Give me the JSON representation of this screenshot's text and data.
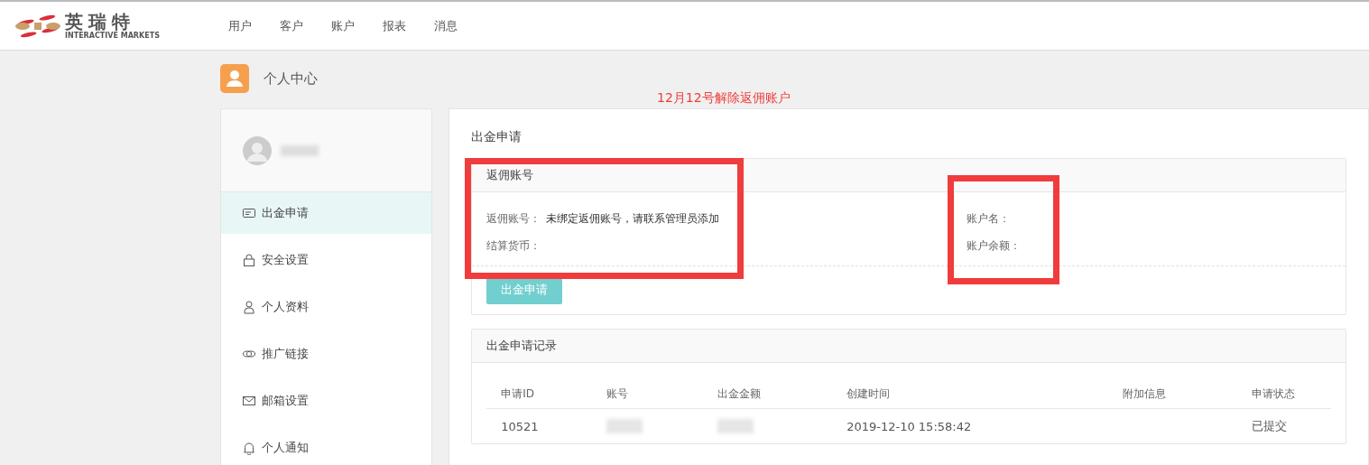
{
  "header": {
    "logo_text": "英瑞特",
    "logo_subtext": "INTERACTIVE MARKETS",
    "nav": [
      {
        "label": "用户",
        "selected": false
      },
      {
        "label": "客户",
        "selected": false
      },
      {
        "label": "账户",
        "selected": false
      },
      {
        "label": "报表",
        "selected": false
      },
      {
        "label": "消息",
        "selected": false
      }
    ]
  },
  "page_title": "个人中心",
  "annotation": {
    "text": "12月12号解除返佣账户",
    "color": "#f03c3c"
  },
  "sidebar": {
    "profile": {
      "name_blurred": true
    },
    "items": [
      {
        "label": "出金申请",
        "kind": "card",
        "selected": true
      },
      {
        "label": "安全设置",
        "kind": "lock",
        "selected": false
      },
      {
        "label": "个人资料",
        "kind": "user",
        "selected": false
      },
      {
        "label": "推广链接",
        "kind": "link",
        "selected": false
      },
      {
        "label": "邮箱设置",
        "kind": "mail",
        "selected": false
      },
      {
        "label": "个人通知",
        "kind": "bell",
        "selected": false
      }
    ]
  },
  "main": {
    "title": "出金申请",
    "rebate_card": {
      "title": "返佣账号",
      "left": [
        {
          "label": "返佣账号：",
          "value": "未绑定返佣账号，请联系管理员添加"
        },
        {
          "label": "结算货币："
        }
      ],
      "right": [
        {
          "label": "账户名："
        },
        {
          "label": "账户余额："
        }
      ],
      "button": "出金申请"
    },
    "records": {
      "title": "出金申请记录",
      "columns": [
        "申请ID",
        "账号",
        "出金金额",
        "创建时间",
        "附加信息",
        "申请状态"
      ],
      "rows": [
        {
          "cells": [
            "10521",
            {
              "blurred": true
            },
            {
              "blurred": true
            },
            "2019-12-10 15:58:42",
            null,
            "已提交"
          ]
        }
      ]
    }
  },
  "highlights": [
    {
      "color": "#f03c3c"
    },
    {
      "color": "#f03c3c"
    }
  ]
}
